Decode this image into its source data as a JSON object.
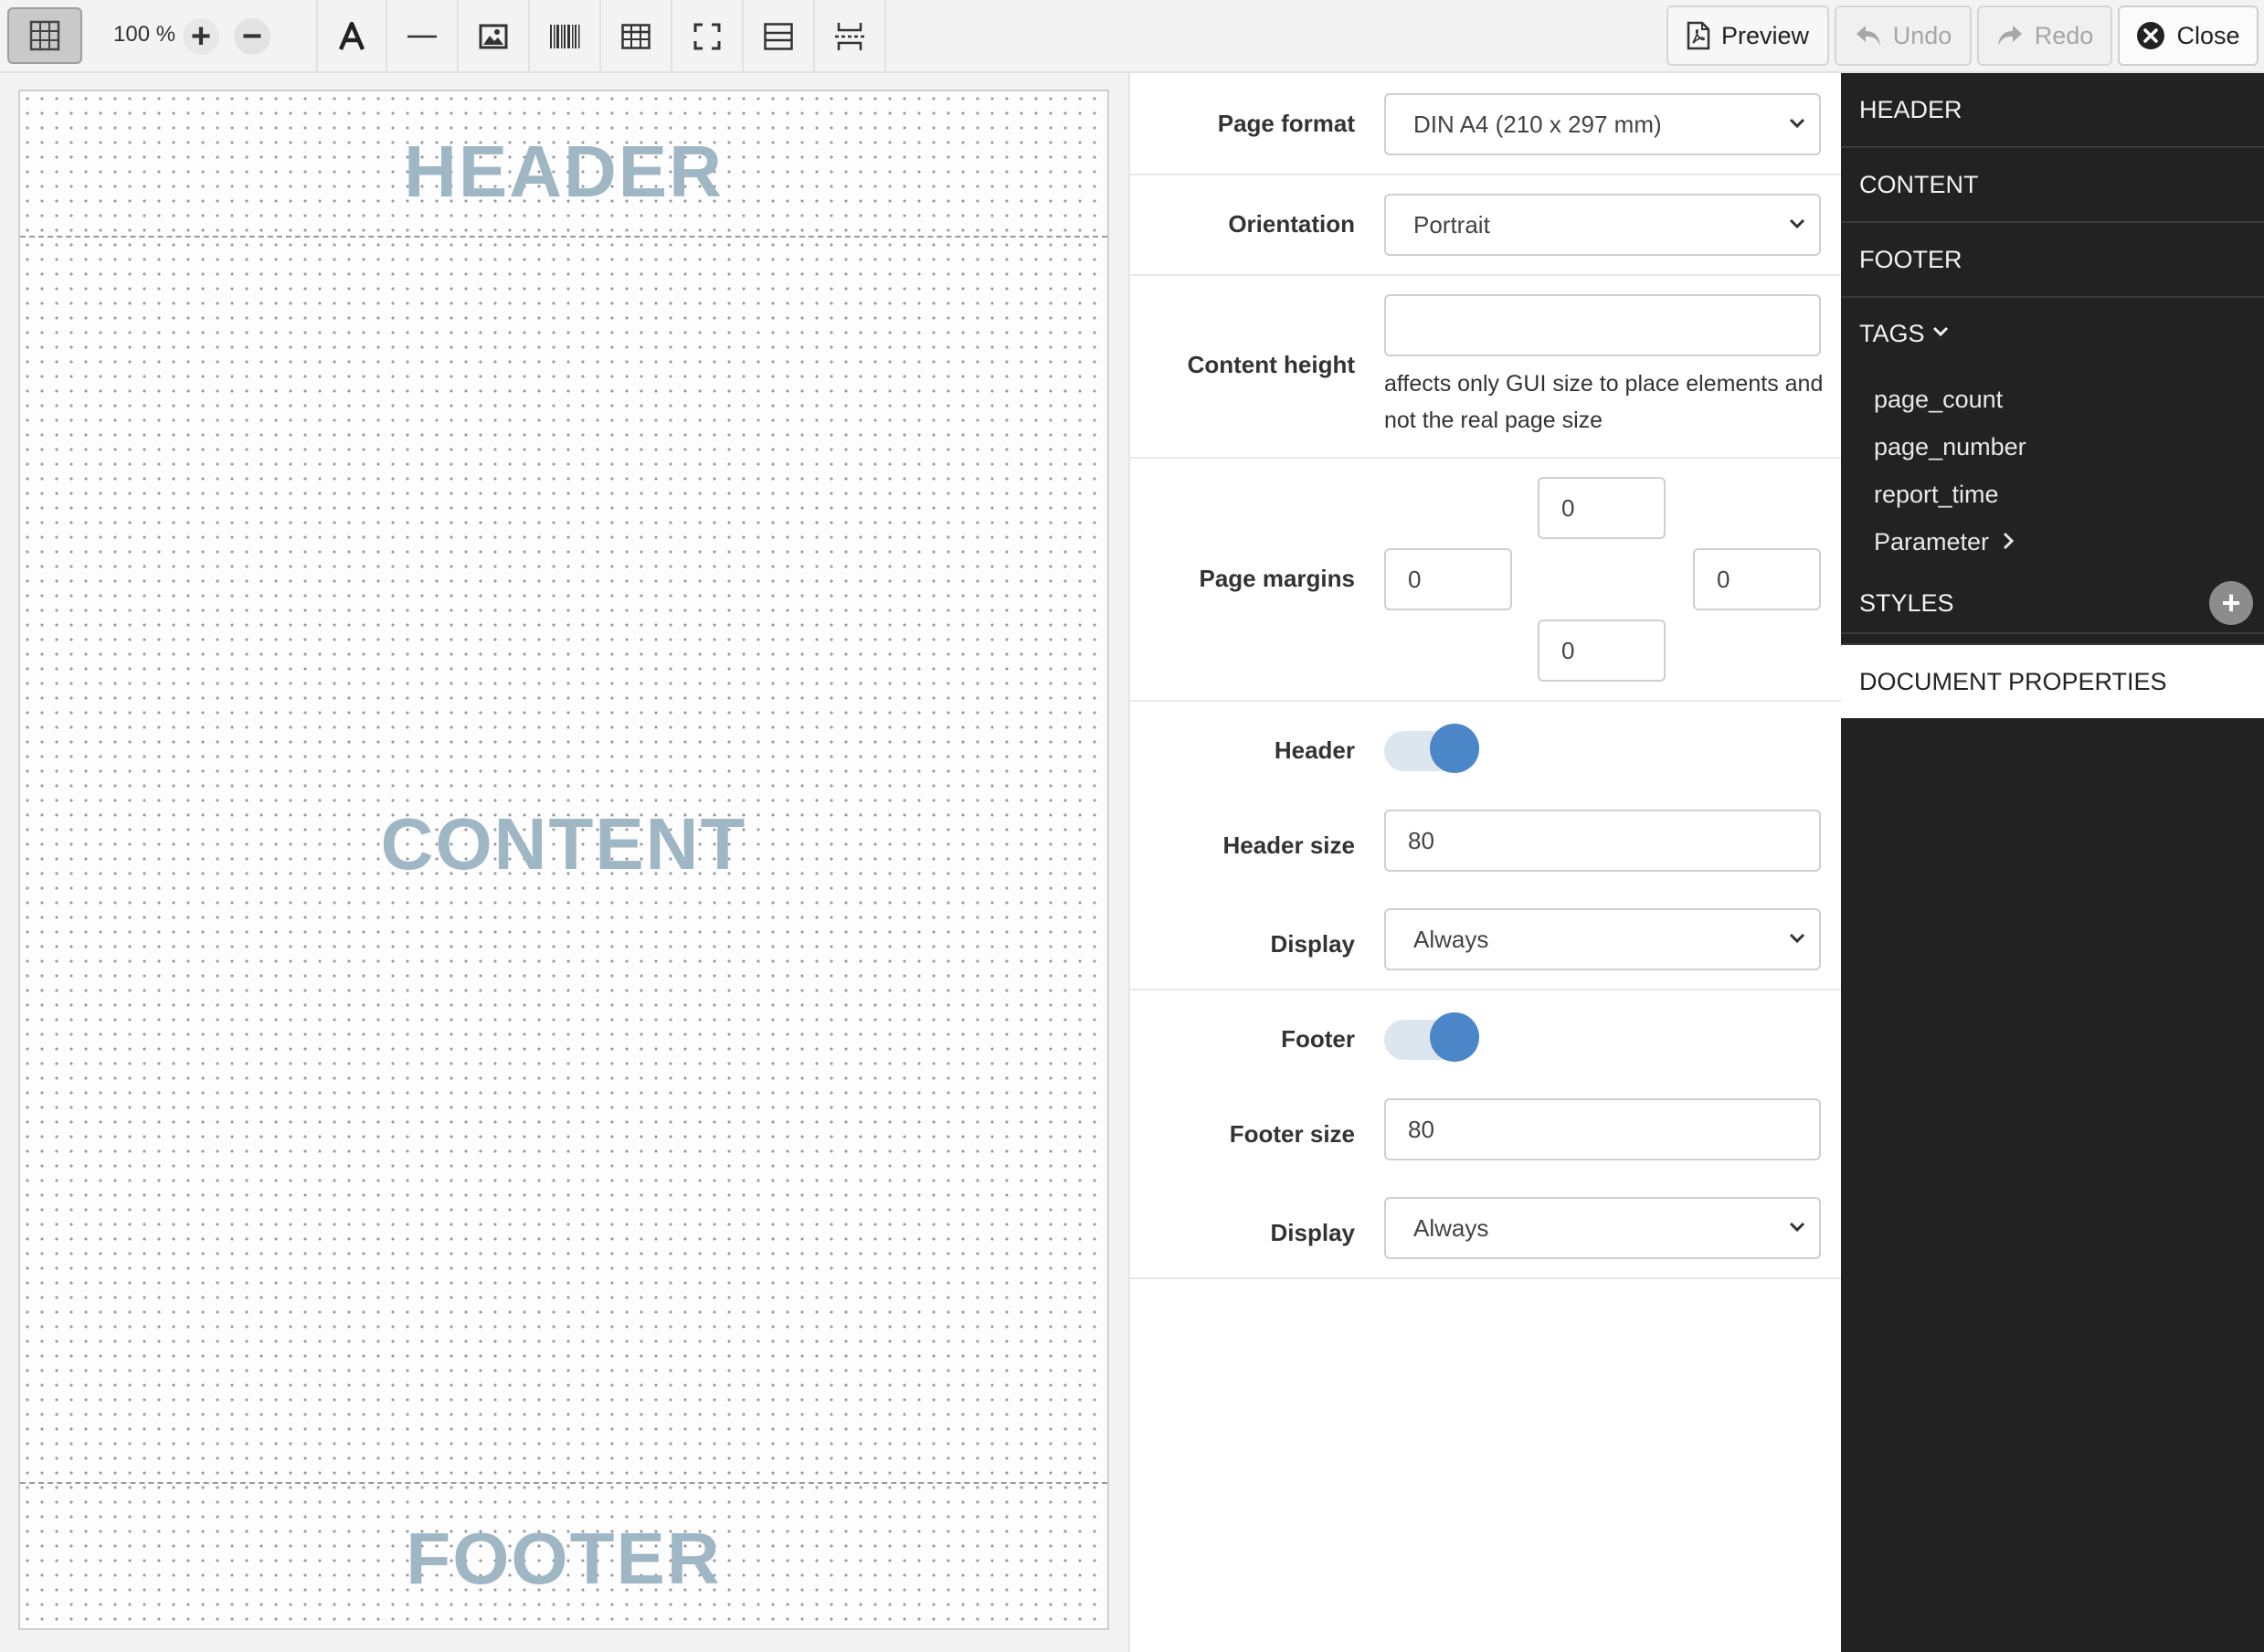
{
  "toolbar": {
    "zoom_label": "100 %",
    "zoom_in": "+",
    "zoom_out": "−",
    "preview_label": "Preview",
    "undo_label": "Undo",
    "redo_label": "Redo",
    "close_label": "Close",
    "tools": [
      "text-tool",
      "line-tool",
      "image-tool",
      "barcode-tool",
      "table-tool",
      "frame-tool",
      "section-tool",
      "page-break-tool"
    ]
  },
  "canvas": {
    "header_label": "HEADER",
    "content_label": "CONTENT",
    "footer_label": "FOOTER"
  },
  "properties": {
    "page_format": {
      "label": "Page format",
      "value": "DIN A4 (210 x 297 mm)"
    },
    "orientation": {
      "label": "Orientation",
      "value": "Portrait"
    },
    "content_height": {
      "label": "Content height",
      "value": "",
      "help": "affects only GUI size to place elements and not the real page size"
    },
    "page_margins": {
      "label": "Page margins",
      "top": "0",
      "left": "0",
      "right": "0",
      "bottom": "0"
    },
    "header": {
      "label": "Header",
      "enabled": true,
      "size_label": "Header size",
      "size": "80",
      "display_label": "Display",
      "display": "Always"
    },
    "footer": {
      "label": "Footer",
      "enabled": true,
      "size_label": "Footer size",
      "size": "80",
      "display_label": "Display",
      "display": "Always"
    }
  },
  "sidebar": {
    "header": "HEADER",
    "content": "CONTENT",
    "footer": "FOOTER",
    "tags": "TAGS",
    "tag_items": [
      "page_count",
      "page_number",
      "report_time",
      "Parameter"
    ],
    "styles": "STYLES",
    "document_properties": "DOCUMENT PROPERTIES"
  },
  "colors": {
    "accent": "#4a86c8",
    "sidebar_bg": "#222222",
    "band_label": "#9fb6c5"
  }
}
